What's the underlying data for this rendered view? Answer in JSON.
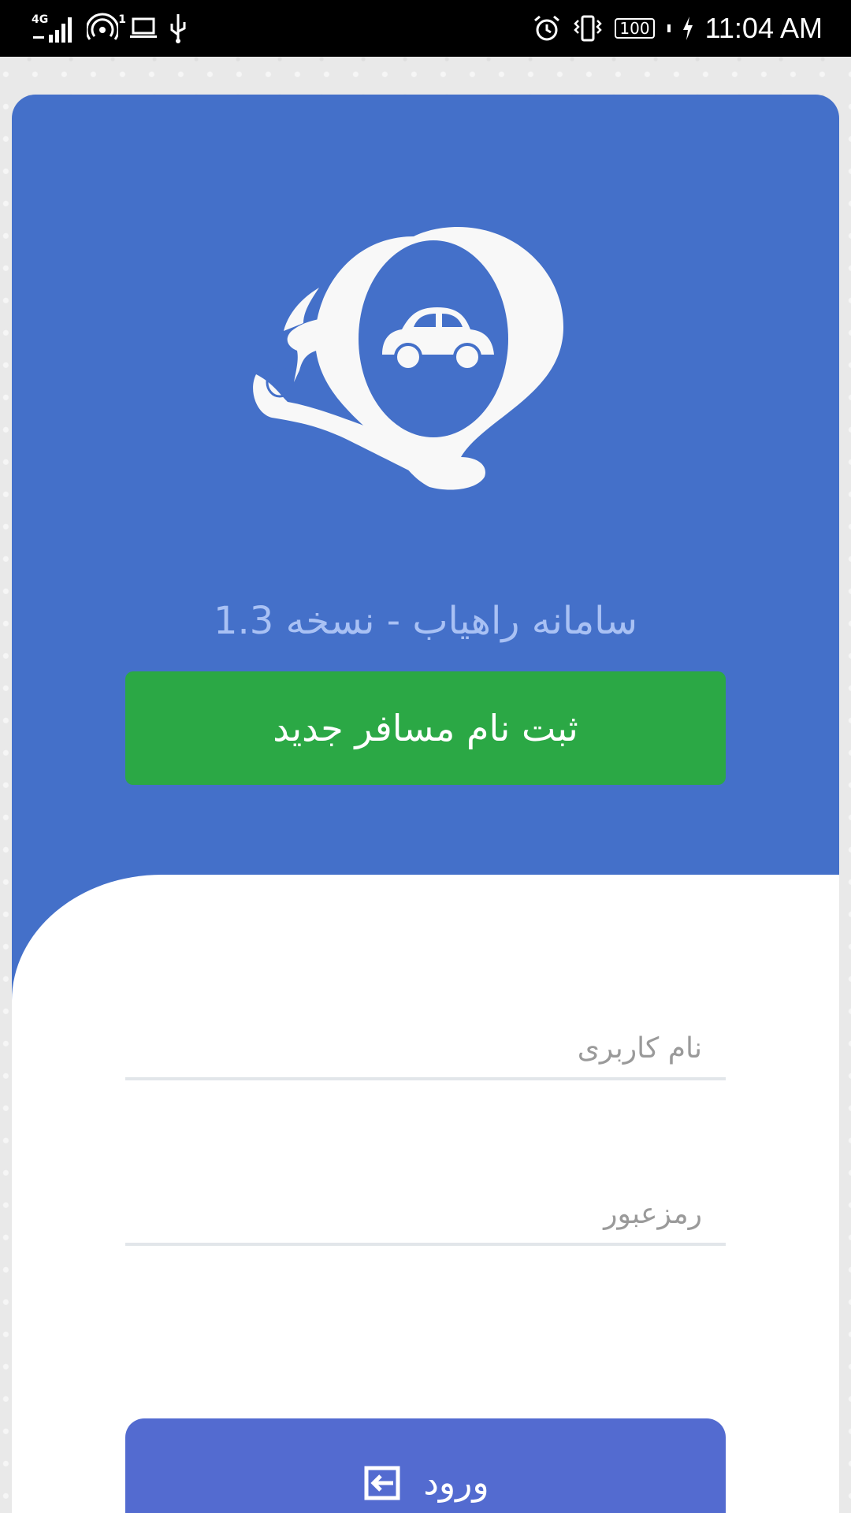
{
  "status_bar": {
    "network_label": "4G",
    "hotspot_count": "1",
    "battery_level": "100",
    "time": "11:04 AM",
    "icons": [
      "signal-icon",
      "hotspot-icon",
      "laptop-icon",
      "usb-icon",
      "alarm-icon",
      "vibrate-icon",
      "battery-icon",
      "charging-icon"
    ]
  },
  "header": {
    "app_title": "سامانه راهیاب - نسخه 1.3",
    "logo_icon": "location-pin-car-icon"
  },
  "register_button": {
    "label": "ثبت نام مسافر جدید",
    "color": "#2ba845"
  },
  "login_form": {
    "username_placeholder": "نام کاربری",
    "username_value": "",
    "password_placeholder": "رمزعبور",
    "password_value": ""
  },
  "login_button": {
    "label": "ورود",
    "icon": "login-icon",
    "color": "#536bd0"
  },
  "colors": {
    "primary_blue": "#4470c9",
    "title_text": "#a9c1f4",
    "background": "#e9e9e9"
  }
}
